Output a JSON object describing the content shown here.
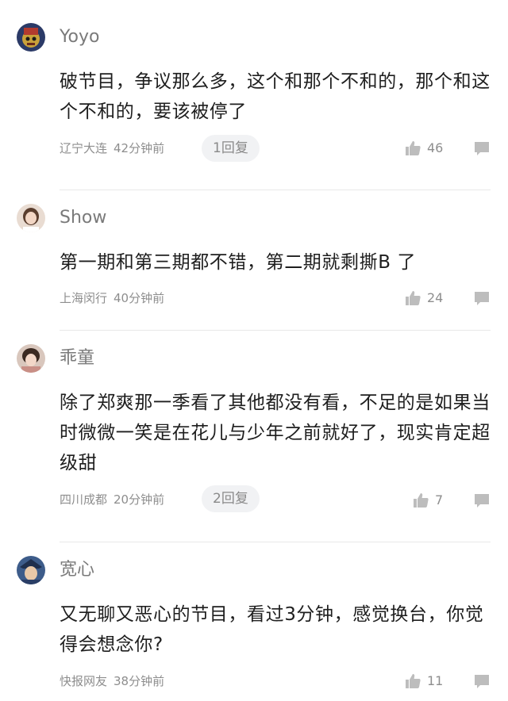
{
  "comments": [
    {
      "user": "Yoyo",
      "text": "破节目，争议那么多，这个和那个不和的，那个和这个不和的，要该被停了",
      "location": "辽宁大连",
      "time": "42分钟前",
      "replies": "1回复",
      "likes": "46"
    },
    {
      "user": "Show",
      "text": "第一期和第三期都不错，第二期就剩撕B 了",
      "location": "上海闵行",
      "time": "40分钟前",
      "replies": "",
      "likes": "24"
    },
    {
      "user": "乖童",
      "text": "除了郑爽那一季看了其他都没有看，不足的是如果当时微微一笑是在花儿与少年之前就好了，现实肯定超级甜",
      "location": "四川成都",
      "time": "20分钟前",
      "replies": "2回复",
      "likes": "7"
    },
    {
      "user": "宽心",
      "text": "又无聊又恶心的节目，看过3分钟，感觉换台，你觉得会想念你?",
      "location": "快报网友",
      "time": "38分钟前",
      "replies": "",
      "likes": "11"
    }
  ],
  "colors": {
    "meta_gray": "#8e8e8e",
    "username_gray": "#7a7a7a",
    "pill_bg": "#f1f2f4",
    "icon_gray": "#bdbdbd"
  },
  "icons": {
    "like": "thumbs-up-icon",
    "reply": "speech-bubble-icon"
  }
}
